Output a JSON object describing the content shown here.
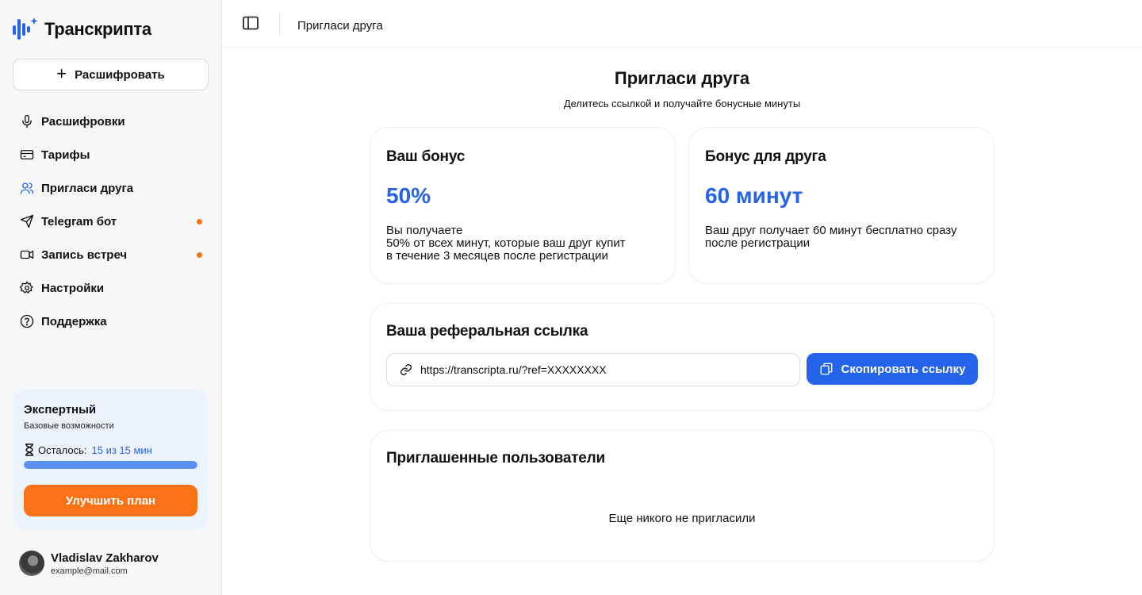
{
  "app": {
    "name": "Транскрипта"
  },
  "sidebar": {
    "new_button_label": "Расшифровать",
    "items": [
      {
        "label": "Расшифровки",
        "icon": "microphone-icon",
        "active": false,
        "badge": false
      },
      {
        "label": "Тарифы",
        "icon": "credit-card-icon",
        "active": false,
        "badge": false
      },
      {
        "label": "Пригласи друга",
        "icon": "users-icon",
        "active": true,
        "badge": false
      },
      {
        "label": "Telegram бот",
        "icon": "send-icon",
        "active": false,
        "badge": true
      },
      {
        "label": "Запись встреч",
        "icon": "video-icon",
        "active": false,
        "badge": true
      },
      {
        "label": "Настройки",
        "icon": "gear-icon",
        "active": false,
        "badge": false
      },
      {
        "label": "Поддержка",
        "icon": "help-circle-icon",
        "active": false,
        "badge": false
      }
    ],
    "plan": {
      "name": "Экспертный",
      "subtitle": "Базовые возможности",
      "remaining_label": "Осталось:",
      "remaining_value": "15 из 15 мин",
      "progress_fraction": 1.0,
      "upgrade_label": "Улучшить план"
    },
    "user": {
      "name": "Vladislav Zakharov",
      "email": "example@mail.com"
    }
  },
  "topbar": {
    "title": "Пригласи друга"
  },
  "main": {
    "title": "Пригласи друга",
    "subtitle": "Делитесь ссылкой и получайте бонусные минуты",
    "your_bonus": {
      "title": "Ваш бонус",
      "value": "50%",
      "description": "Вы получаете\n50% от всех минут, которые ваш друг купит\nв течение 3 месяцев после регистрации"
    },
    "friend_bonus": {
      "title": "Бонус для друга",
      "value": "60 минут",
      "description": "Ваш друг получает 60 минут бесплатно сразу\nпосле регистрации"
    },
    "referral": {
      "title": "Ваша реферальная ссылка",
      "link": "https://transcripta.ru/?ref=XXXXXXXX",
      "copy_label": "Скопировать ссылку"
    },
    "invited": {
      "title": "Приглашенные пользователи",
      "empty_text": "Еще никого не пригласили"
    }
  },
  "colors": {
    "accent": "#2563eb",
    "orange": "#f97316",
    "sidebar_bg": "#f7f7f7",
    "plan_bg": "#edf3fd"
  }
}
